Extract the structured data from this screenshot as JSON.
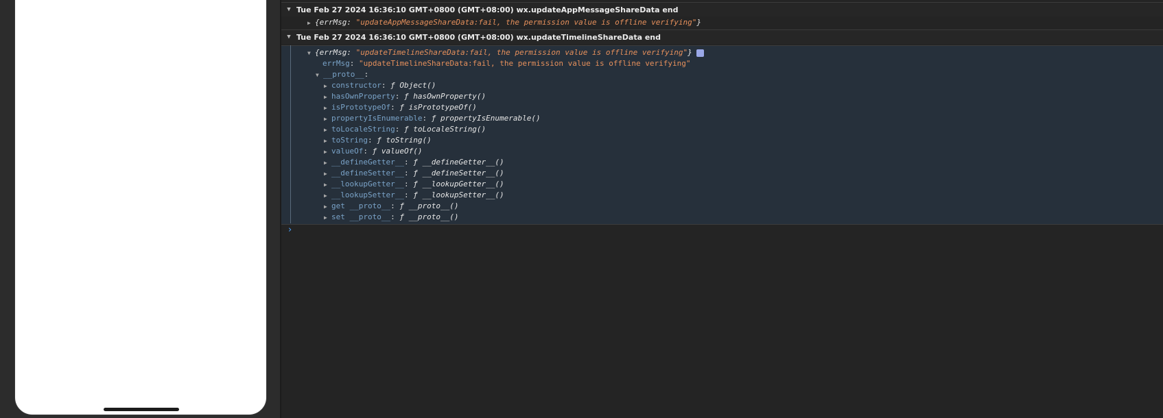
{
  "simulator": {},
  "console": {
    "logs": [
      {
        "title": "Tue Feb 27 2024 16:36:10 GMT+0800 (GMT+08:00) wx.updateAppMessageShareData end",
        "summary_key": "errMsg",
        "summary_value": "\"updateAppMessageShareData:fail, the permission value is offline verifying\""
      },
      {
        "title": "Tue Feb 27 2024 16:36:10 GMT+0800 (GMT+08:00) wx.updateTimelineShareData end",
        "summary_key": "errMsg",
        "summary_value": "\"updateTimelineShareData:fail, the permission value is offline verifying\"",
        "expanded": {
          "prop_key": "errMsg",
          "prop_value": "\"updateTimelineShareData:fail, the permission value is offline verifying\"",
          "proto_label": "__proto__",
          "proto_members": [
            {
              "key": "constructor",
              "fn": "Object()"
            },
            {
              "key": "hasOwnProperty",
              "fn": "hasOwnProperty()"
            },
            {
              "key": "isPrototypeOf",
              "fn": "isPrototypeOf()"
            },
            {
              "key": "propertyIsEnumerable",
              "fn": "propertyIsEnumerable()"
            },
            {
              "key": "toLocaleString",
              "fn": "toLocaleString()"
            },
            {
              "key": "toString",
              "fn": "toString()"
            },
            {
              "key": "valueOf",
              "fn": "valueOf()"
            },
            {
              "key": "__defineGetter__",
              "fn": "__defineGetter__()"
            },
            {
              "key": "__defineSetter__",
              "fn": "__defineSetter__()"
            },
            {
              "key": "__lookupGetter__",
              "fn": "__lookupGetter__()"
            },
            {
              "key": "__lookupSetter__",
              "fn": "__lookupSetter__()"
            },
            {
              "key": "get __proto__",
              "fn": "__proto__()"
            },
            {
              "key": "set __proto__",
              "fn": "__proto__()"
            }
          ]
        }
      }
    ],
    "prompt_symbol": "›"
  },
  "colors": {
    "console_bg": "#242424",
    "expanded_bg": "#26303b",
    "key": "#7aa3c8",
    "string": "#e6905c",
    "prompt": "#4da3ff"
  },
  "icons": {
    "collapse": "triangle-down-icon",
    "expand": "triangle-right-icon",
    "info": "info-badge-icon",
    "function": "function-f-icon"
  }
}
